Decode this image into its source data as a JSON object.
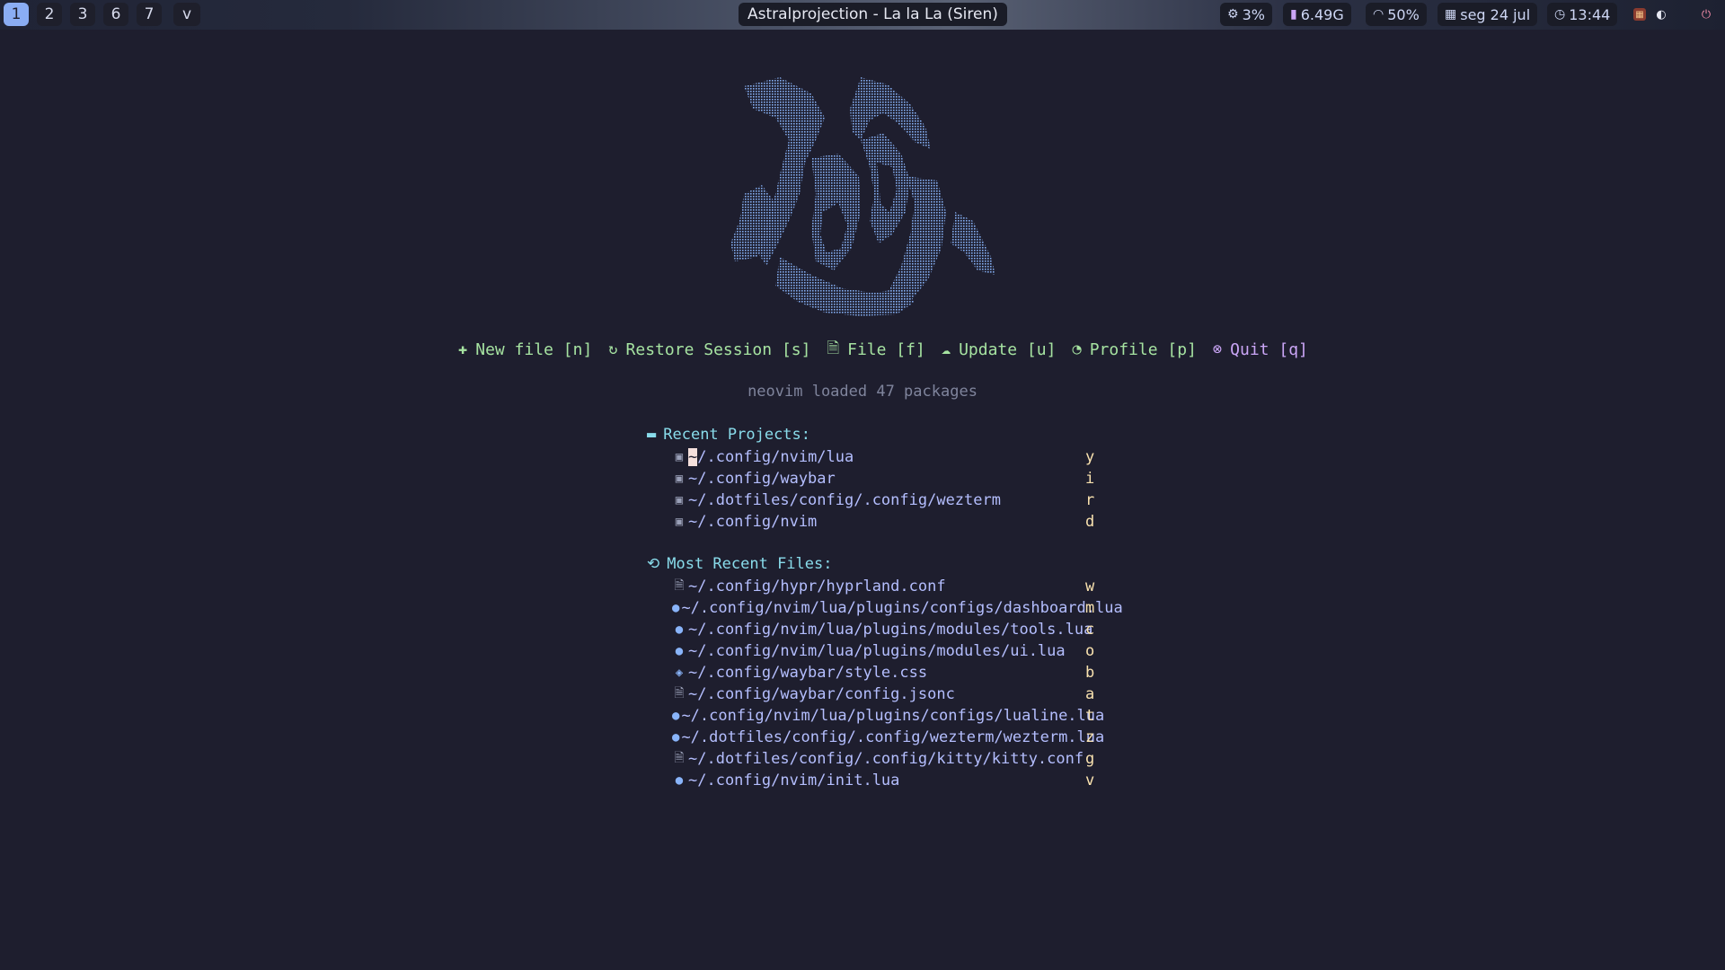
{
  "topbar": {
    "workspaces": [
      "1",
      "2",
      "3",
      "6",
      "7",
      "v"
    ],
    "active_workspace": "1",
    "window_title": "Astralprojection - La la La (Siren)",
    "cpu": "3%",
    "memory": "6.49G",
    "brightness": "50%",
    "date": "seg 24 jul",
    "time": "13:44"
  },
  "dashboard": {
    "actions": [
      {
        "icon": "plus-icon",
        "label": "New file [n]"
      },
      {
        "icon": "refresh-icon",
        "label": "Restore Session [s]"
      },
      {
        "icon": "file-search-icon",
        "label": "File [f]"
      },
      {
        "icon": "cloud-upload-icon",
        "label": "Update [u]"
      },
      {
        "icon": "gauge-icon",
        "label": "Profile [p]"
      },
      {
        "icon": "close-circle-icon",
        "label": "Quit [q]"
      }
    ],
    "loaded_message": "neovim loaded 47 packages",
    "recent_projects_title": "Recent Projects:",
    "recent_projects": [
      {
        "path": "~/.config/nvim/lua",
        "key": "y"
      },
      {
        "path": "~/.config/waybar",
        "key": "i"
      },
      {
        "path": "~/.dotfiles/config/.config/wezterm",
        "key": "r"
      },
      {
        "path": "~/.config/nvim",
        "key": "d"
      }
    ],
    "recent_files_title": "Most Recent Files:",
    "recent_files": [
      {
        "path": "~/.config/hypr/hyprland.conf",
        "key": "w",
        "type": "text"
      },
      {
        "path": "~/.config/nvim/lua/plugins/configs/dashboard.lua",
        "key": "m",
        "type": "lua"
      },
      {
        "path": "~/.config/nvim/lua/plugins/modules/tools.lua",
        "key": "c",
        "type": "lua"
      },
      {
        "path": "~/.config/nvim/lua/plugins/modules/ui.lua",
        "key": "o",
        "type": "lua"
      },
      {
        "path": "~/.config/waybar/style.css",
        "key": "b",
        "type": "css"
      },
      {
        "path": "~/.config/waybar/config.jsonc",
        "key": "a",
        "type": "text"
      },
      {
        "path": "~/.config/nvim/lua/plugins/configs/lualine.lua",
        "key": "t",
        "type": "lua"
      },
      {
        "path": "~/.dotfiles/config/.config/wezterm/wezterm.lua",
        "key": "z",
        "type": "lua"
      },
      {
        "path": "~/.dotfiles/config/.config/kitty/kitty.conf",
        "key": "g",
        "type": "text"
      },
      {
        "path": "~/.config/nvim/init.lua",
        "key": "v",
        "type": "lua"
      }
    ]
  },
  "colors": {
    "background": "#1e1e2e",
    "accent_green": "#a6e3a1",
    "accent_purple": "#cba6f7",
    "accent_blue": "#89dceb",
    "path_color": "#b4befe",
    "key_color": "#f9e2af"
  }
}
